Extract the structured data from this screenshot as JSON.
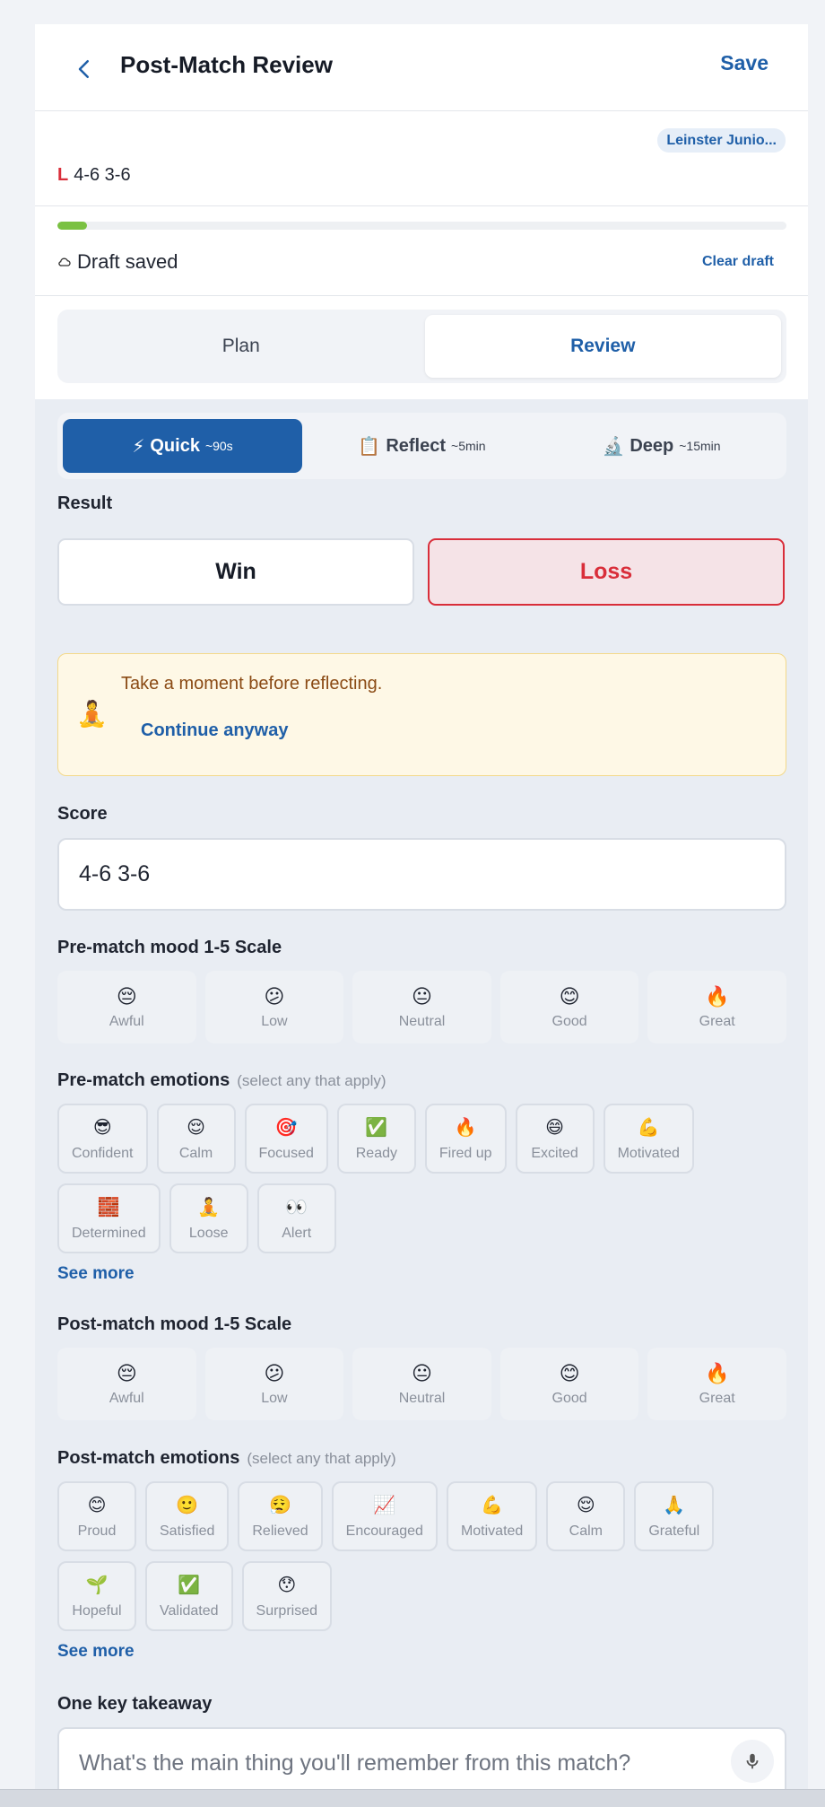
{
  "header": {
    "title": "Post-Match Review",
    "save_label": "Save"
  },
  "match": {
    "league": "Leinster Junio...",
    "result_letter": "L",
    "score": "4-6 3-6"
  },
  "draft": {
    "progress_percent": 4,
    "status": "Draft saved",
    "clear_label": "Clear draft"
  },
  "modes": [
    {
      "label": "Plan",
      "active": false
    },
    {
      "label": "Review",
      "active": true
    }
  ],
  "depth": [
    {
      "icon": "⚡",
      "label": "Quick",
      "duration": "~90s",
      "active": true
    },
    {
      "icon": "📋",
      "label": "Reflect",
      "duration": "~5min",
      "active": false
    },
    {
      "icon": "🔬",
      "label": "Deep",
      "duration": "~15min",
      "active": false
    }
  ],
  "result": {
    "label": "Result",
    "win": "Win",
    "loss": "Loss",
    "selected": "Loss"
  },
  "notice": {
    "icon": "🧘",
    "text": "Take a moment before reflecting.",
    "action": "Continue anyway"
  },
  "score": {
    "label": "Score",
    "value": "4-6 3-6"
  },
  "pre_mood": {
    "label": "Pre-match mood 1-5 Scale",
    "options": [
      {
        "emoji": "😔",
        "label": "Awful"
      },
      {
        "emoji": "😕",
        "label": "Low"
      },
      {
        "emoji": "😐",
        "label": "Neutral"
      },
      {
        "emoji": "😊",
        "label": "Good"
      },
      {
        "emoji": "🔥",
        "label": "Great"
      }
    ]
  },
  "pre_emotions": {
    "label": "Pre-match emotions",
    "sub": "(select any that apply)",
    "options": [
      {
        "emoji": "😎",
        "label": "Confident"
      },
      {
        "emoji": "😌",
        "label": "Calm"
      },
      {
        "emoji": "🎯",
        "label": "Focused"
      },
      {
        "emoji": "✅",
        "label": "Ready"
      },
      {
        "emoji": "🔥",
        "label": "Fired up"
      },
      {
        "emoji": "😄",
        "label": "Excited"
      },
      {
        "emoji": "💪",
        "label": "Motivated"
      },
      {
        "emoji": "🧱",
        "label": "Determined"
      },
      {
        "emoji": "🧘",
        "label": "Loose"
      },
      {
        "emoji": "👀",
        "label": "Alert"
      }
    ],
    "see_more": "See more"
  },
  "post_mood": {
    "label": "Post-match mood 1-5 Scale",
    "options": [
      {
        "emoji": "😔",
        "label": "Awful"
      },
      {
        "emoji": "😕",
        "label": "Low"
      },
      {
        "emoji": "😐",
        "label": "Neutral"
      },
      {
        "emoji": "😊",
        "label": "Good"
      },
      {
        "emoji": "🔥",
        "label": "Great"
      }
    ]
  },
  "post_emotions": {
    "label": "Post-match emotions",
    "sub": "(select any that apply)",
    "options": [
      {
        "emoji": "😊",
        "label": "Proud"
      },
      {
        "emoji": "🙂",
        "label": "Satisfied"
      },
      {
        "emoji": "😮‍💨",
        "label": "Relieved"
      },
      {
        "emoji": "📈",
        "label": "Encouraged"
      },
      {
        "emoji": "💪",
        "label": "Motivated"
      },
      {
        "emoji": "😌",
        "label": "Calm"
      },
      {
        "emoji": "🙏",
        "label": "Grateful"
      },
      {
        "emoji": "🌱",
        "label": "Hopeful"
      },
      {
        "emoji": "✅",
        "label": "Validated"
      },
      {
        "emoji": "😯",
        "label": "Surprised"
      }
    ],
    "see_more": "See more"
  },
  "takeaway": {
    "label": "One key takeaway",
    "placeholder": "What's the main thing you'll remember from this match?"
  },
  "colors": {
    "accent": "#1f5fa8",
    "loss": "#d92e3a",
    "progress": "#7ac142",
    "notice_bg": "#fef8e6"
  }
}
